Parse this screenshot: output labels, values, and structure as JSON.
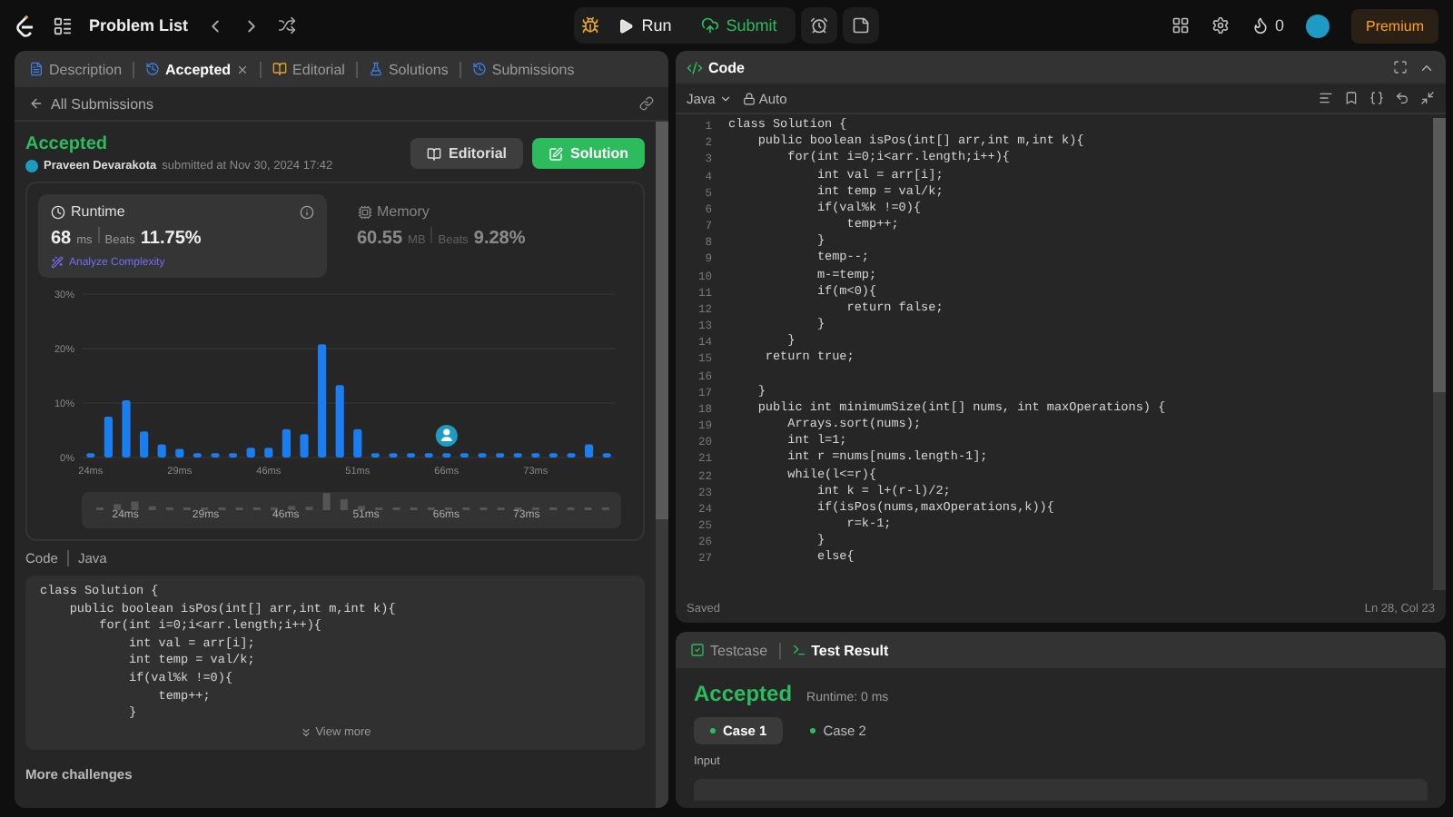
{
  "top_bar": {
    "problem_list": "Problem List",
    "run": "Run",
    "submit": "Submit",
    "streak": "0",
    "premium": "Premium"
  },
  "left_tabs": [
    {
      "label": "Description",
      "kind": "description",
      "selected": false
    },
    {
      "label": "Accepted",
      "kind": "accepted",
      "selected": true
    },
    {
      "label": "Editorial",
      "kind": "editorial",
      "selected": false
    },
    {
      "label": "Solutions",
      "kind": "solutions",
      "selected": false
    },
    {
      "label": "Submissions",
      "kind": "submissions",
      "selected": false
    }
  ],
  "back_link": "All Submissions",
  "submission": {
    "status": "Accepted",
    "author": "Praveen Devarakota",
    "submitted": "submitted at Nov 30, 2024 17:42",
    "buttons": [
      {
        "label": "Editorial",
        "kind": "secondary"
      },
      {
        "label": "Solution",
        "kind": "primary"
      }
    ]
  },
  "metrics": [
    {
      "kind": "runtime",
      "label": "Runtime",
      "value": "68",
      "unit": "ms",
      "beats_label": "Beats",
      "beats": "11.75%",
      "link": "Analyze Complexity",
      "selected": true
    },
    {
      "kind": "memory",
      "label": "Memory",
      "value": "60.55",
      "unit": "MB",
      "beats_label": "Beats",
      "beats": "9.28%",
      "selected": false
    }
  ],
  "chart_data": {
    "type": "bar",
    "categories": [
      "24ms",
      null,
      null,
      null,
      null,
      "29ms",
      null,
      null,
      null,
      null,
      "46ms",
      null,
      null,
      null,
      null,
      "51ms",
      null,
      null,
      null,
      null,
      "66ms",
      null,
      null,
      null,
      null,
      "73ms",
      null,
      null,
      null,
      null
    ],
    "values": [
      0.8,
      7.5,
      10.5,
      4.8,
      2.4,
      1.6,
      0.8,
      0.8,
      0.8,
      1.8,
      1.8,
      5.2,
      4.3,
      20.8,
      13.3,
      5.2,
      0.8,
      0.8,
      0.8,
      0.8,
      0.8,
      0.8,
      0.8,
      0.8,
      0.8,
      0.8,
      0.8,
      0.8,
      2.4,
      0.8
    ],
    "ylim": [
      0,
      30
    ],
    "yticks": [
      {
        "value": 0,
        "label": "0%"
      },
      {
        "value": 10,
        "label": "10%"
      },
      {
        "value": 20,
        "label": "20%"
      },
      {
        "value": 30,
        "label": "30%"
      }
    ],
    "annotations": [
      {
        "x": "66ms"
      }
    ]
  },
  "overview_labels": [
    "24ms",
    "29ms",
    "46ms",
    "51ms",
    "66ms",
    "73ms"
  ],
  "code_preview": {
    "label": "Code",
    "language": "Java",
    "lines": [
      "class Solution {",
      "    public boolean isPos(int[] arr,int m,int k){",
      "        for(int i=0;i<arr.length;i++){",
      "            int val = arr[i];",
      "            int temp = val/k;",
      "            if(val%k !=0){",
      "                temp++;",
      "            }"
    ],
    "view_more": "View more"
  },
  "more_challenges": "More challenges",
  "editor": {
    "title": "Code",
    "language": "Java",
    "mode": "Auto",
    "lines": [
      {
        "n": "1",
        "code": "class Solution {"
      },
      {
        "n": "2",
        "code": "    public boolean isPos(int[] arr,int m,int k){"
      },
      {
        "n": "3",
        "code": "        for(int i=0;i<arr.length;i++){"
      },
      {
        "n": "4",
        "code": "            int val = arr[i];"
      },
      {
        "n": "5",
        "code": "            int temp = val/k;"
      },
      {
        "n": "6",
        "code": "            if(val%k !=0){"
      },
      {
        "n": "7",
        "code": "                temp++;"
      },
      {
        "n": "8",
        "code": "            }"
      },
      {
        "n": "9",
        "code": "            temp--;"
      },
      {
        "n": "10",
        "code": "            m-=temp;"
      },
      {
        "n": "11",
        "code": "            if(m<0){"
      },
      {
        "n": "12",
        "code": "                return false;"
      },
      {
        "n": "13",
        "code": "            }"
      },
      {
        "n": "14",
        "code": "        }"
      },
      {
        "n": "15",
        "code": "     return true;"
      },
      {
        "n": "16"
      },
      {
        "n": "17",
        "code": "    }"
      },
      {
        "n": "18",
        "code": "    public int minimumSize(int[] nums, int maxOperations) {"
      },
      {
        "n": "19",
        "code": "        Arrays.sort(nums);"
      },
      {
        "n": "20",
        "code": "        int l=1;"
      },
      {
        "n": "21",
        "code": "        int r =nums[nums.length-1];"
      },
      {
        "n": "22",
        "code": "        while(l<=r){"
      },
      {
        "n": "23",
        "code": "            int k = l+(r-l)/2;"
      },
      {
        "n": "24",
        "code": "            if(isPos(nums,maxOperations,k)){"
      },
      {
        "n": "25",
        "code": "                r=k-1;"
      },
      {
        "n": "26",
        "code": "            }"
      },
      {
        "n": "27",
        "code": "            else{"
      }
    ],
    "status": "Saved",
    "cursor": "Ln 28, Col 23"
  },
  "bottom_tabs": [
    {
      "label": "Testcase",
      "kind": "testcase",
      "selected": false
    },
    {
      "label": "Test Result",
      "kind": "result",
      "selected": true
    }
  ],
  "result": {
    "status": "Accepted",
    "runtime": "Runtime: 0 ms",
    "cases": [
      {
        "label": "Case 1",
        "selected": true
      },
      {
        "label": "Case 2",
        "selected": false
      }
    ],
    "input_label": "Input"
  }
}
